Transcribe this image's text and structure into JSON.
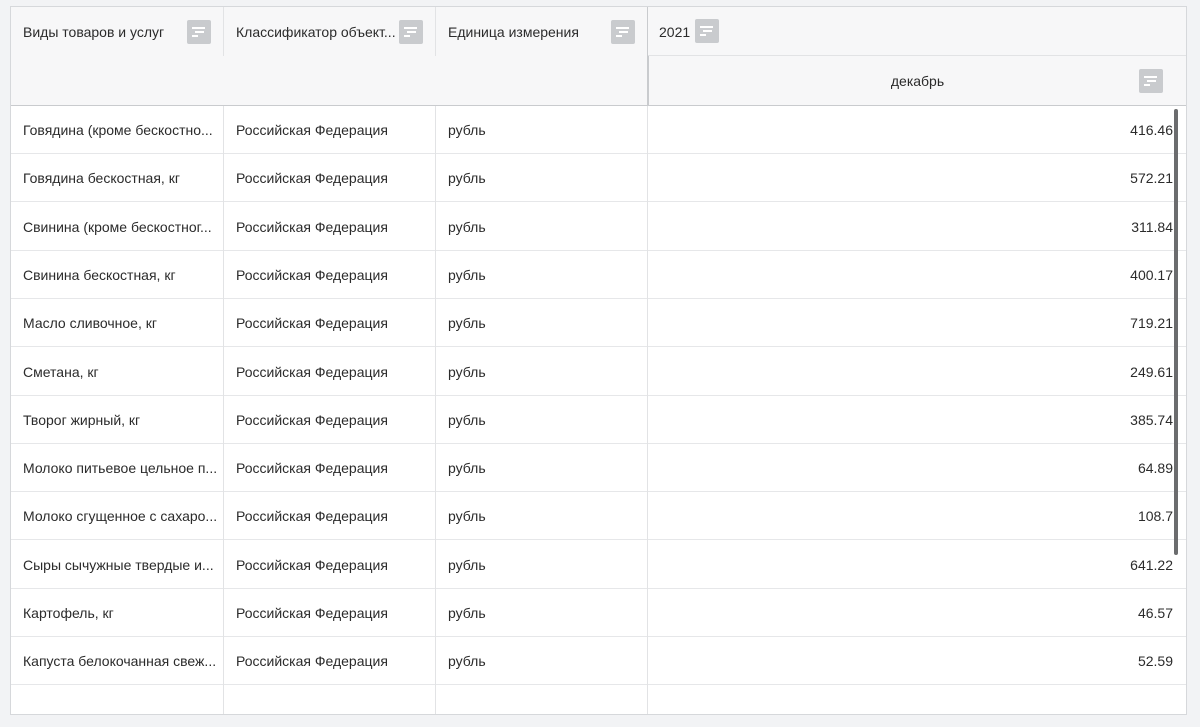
{
  "header": {
    "col1": "Виды товаров и услуг",
    "col2": "Классификатор объект...",
    "col3": "Единица измерения",
    "year": "2021",
    "month": "декабрь"
  },
  "rows": [
    {
      "item": "Говядина (кроме бескостно...",
      "region": "Российская Федерация",
      "unit": "рубль",
      "value": "416.46"
    },
    {
      "item": "Говядина бескостная, кг",
      "region": "Российская Федерация",
      "unit": "рубль",
      "value": "572.21"
    },
    {
      "item": "Свинина (кроме бескостног...",
      "region": "Российская Федерация",
      "unit": "рубль",
      "value": "311.84"
    },
    {
      "item": "Свинина бескостная, кг",
      "region": "Российская Федерация",
      "unit": "рубль",
      "value": "400.17"
    },
    {
      "item": "Масло сливочное, кг",
      "region": "Российская Федерация",
      "unit": "рубль",
      "value": "719.21"
    },
    {
      "item": "Сметана, кг",
      "region": "Российская Федерация",
      "unit": "рубль",
      "value": "249.61"
    },
    {
      "item": "Творог жирный, кг",
      "region": "Российская Федерация",
      "unit": "рубль",
      "value": "385.74"
    },
    {
      "item": "Молоко питьевое цельное п...",
      "region": "Российская Федерация",
      "unit": "рубль",
      "value": "64.89"
    },
    {
      "item": "Молоко сгущенное с сахаро...",
      "region": "Российская Федерация",
      "unit": "рубль",
      "value": "108.7"
    },
    {
      "item": "Сыры сычужные твердые и...",
      "region": "Российская Федерация",
      "unit": "рубль",
      "value": "641.22"
    },
    {
      "item": "Картофель, кг",
      "region": "Российская Федерация",
      "unit": "рубль",
      "value": "46.57"
    },
    {
      "item": "Капуста белокочанная свеж...",
      "region": "Российская Федерация",
      "unit": "рубль",
      "value": "52.59"
    }
  ]
}
